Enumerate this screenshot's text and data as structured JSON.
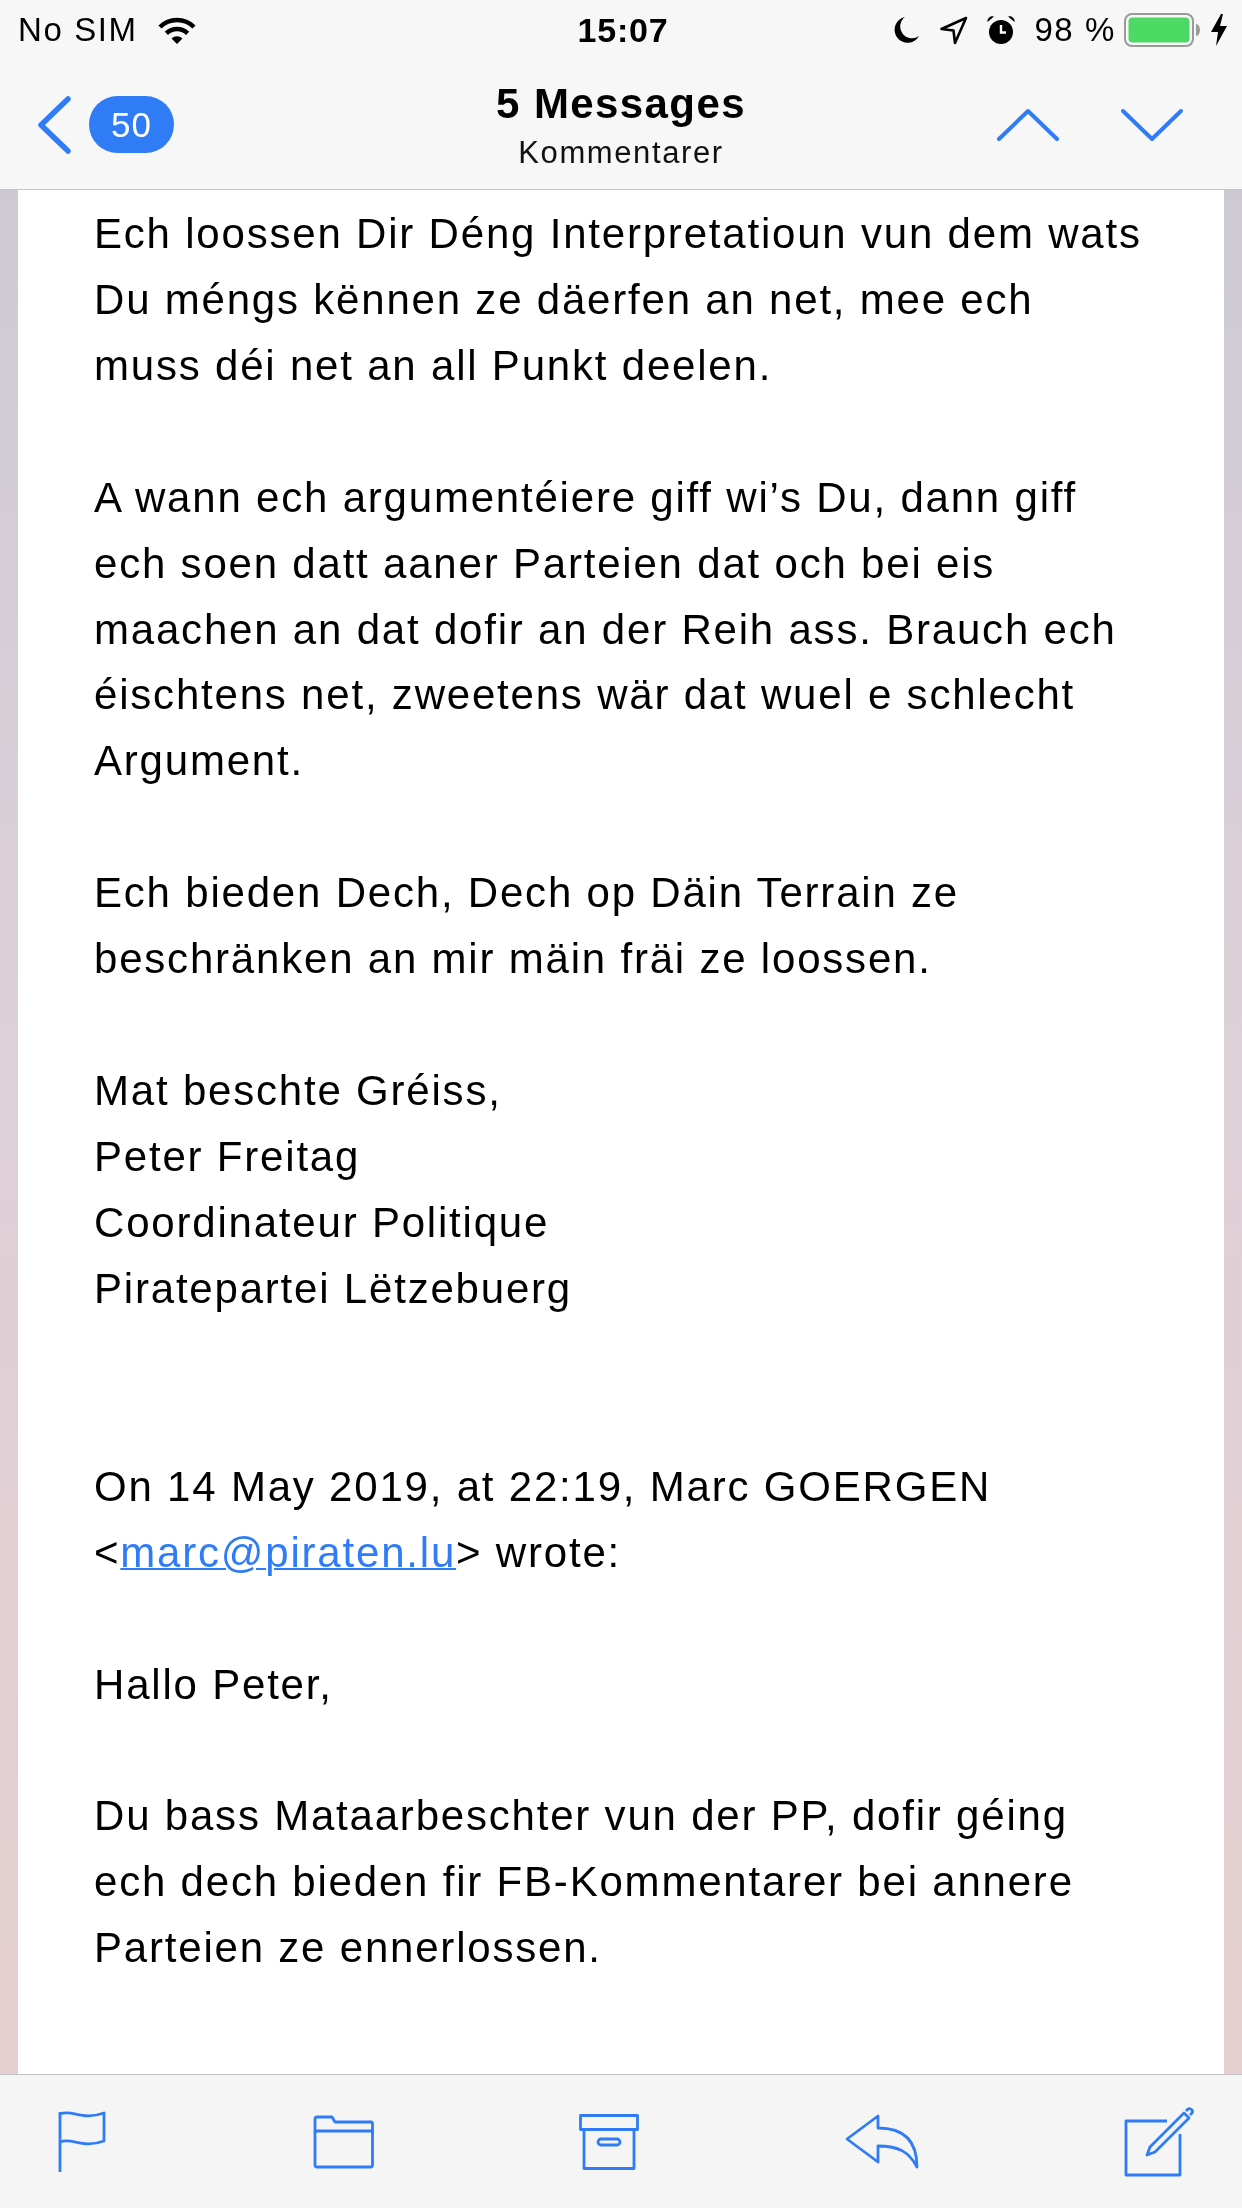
{
  "status_bar": {
    "carrier": "No SIM",
    "time": "15:07",
    "battery_percent": "98 %"
  },
  "nav_bar": {
    "back_badge": "50",
    "title": "5 Messages",
    "subtitle": "Kommentarer"
  },
  "message": {
    "blocks": [
      {
        "kind": "paragraph",
        "lines": [
          "Ech loossen Dir Déng Interpretatioun vun dem wats",
          "Du méngs kënnen ze däerfen an net, mee ech",
          "muss déi net an all Punkt deelen."
        ]
      },
      {
        "kind": "paragraph",
        "lines": [
          "A wann ech argumentéiere giff wi’s Du, dann giff",
          "ech soen datt aaner Parteien dat och bei eis",
          "maachen an dat dofir an der Reih ass. Brauch ech",
          "éischtens net, zweetens wär dat wuel e schlecht",
          "Argument."
        ]
      },
      {
        "kind": "paragraph",
        "lines": [
          "Ech bieden Dech, Dech op Däin Terrain ze",
          "beschränken an mir mäin fräi ze loossen."
        ]
      },
      {
        "kind": "signature",
        "lines": [
          "Mat beschte Gréiss,",
          "Peter Freitag",
          "Coordinateur Politique",
          "Piratepartei Lëtzebuerg"
        ]
      },
      {
        "kind": "quote_header",
        "line_1": "On 14 May 2019, at 22:19, Marc GOERGEN",
        "before_link": "<",
        "email": "marc@piraten.lu",
        "after_link": "> wrote:"
      },
      {
        "kind": "paragraph",
        "lines": [
          "Hallo Peter,"
        ]
      },
      {
        "kind": "paragraph",
        "lines": [
          "Du bass Mataarbeschter vun der PP, dofir géing",
          "ech dech bieden fir FB-Kommentarer bei annere",
          "Parteien ze ennerlossen."
        ]
      }
    ]
  }
}
